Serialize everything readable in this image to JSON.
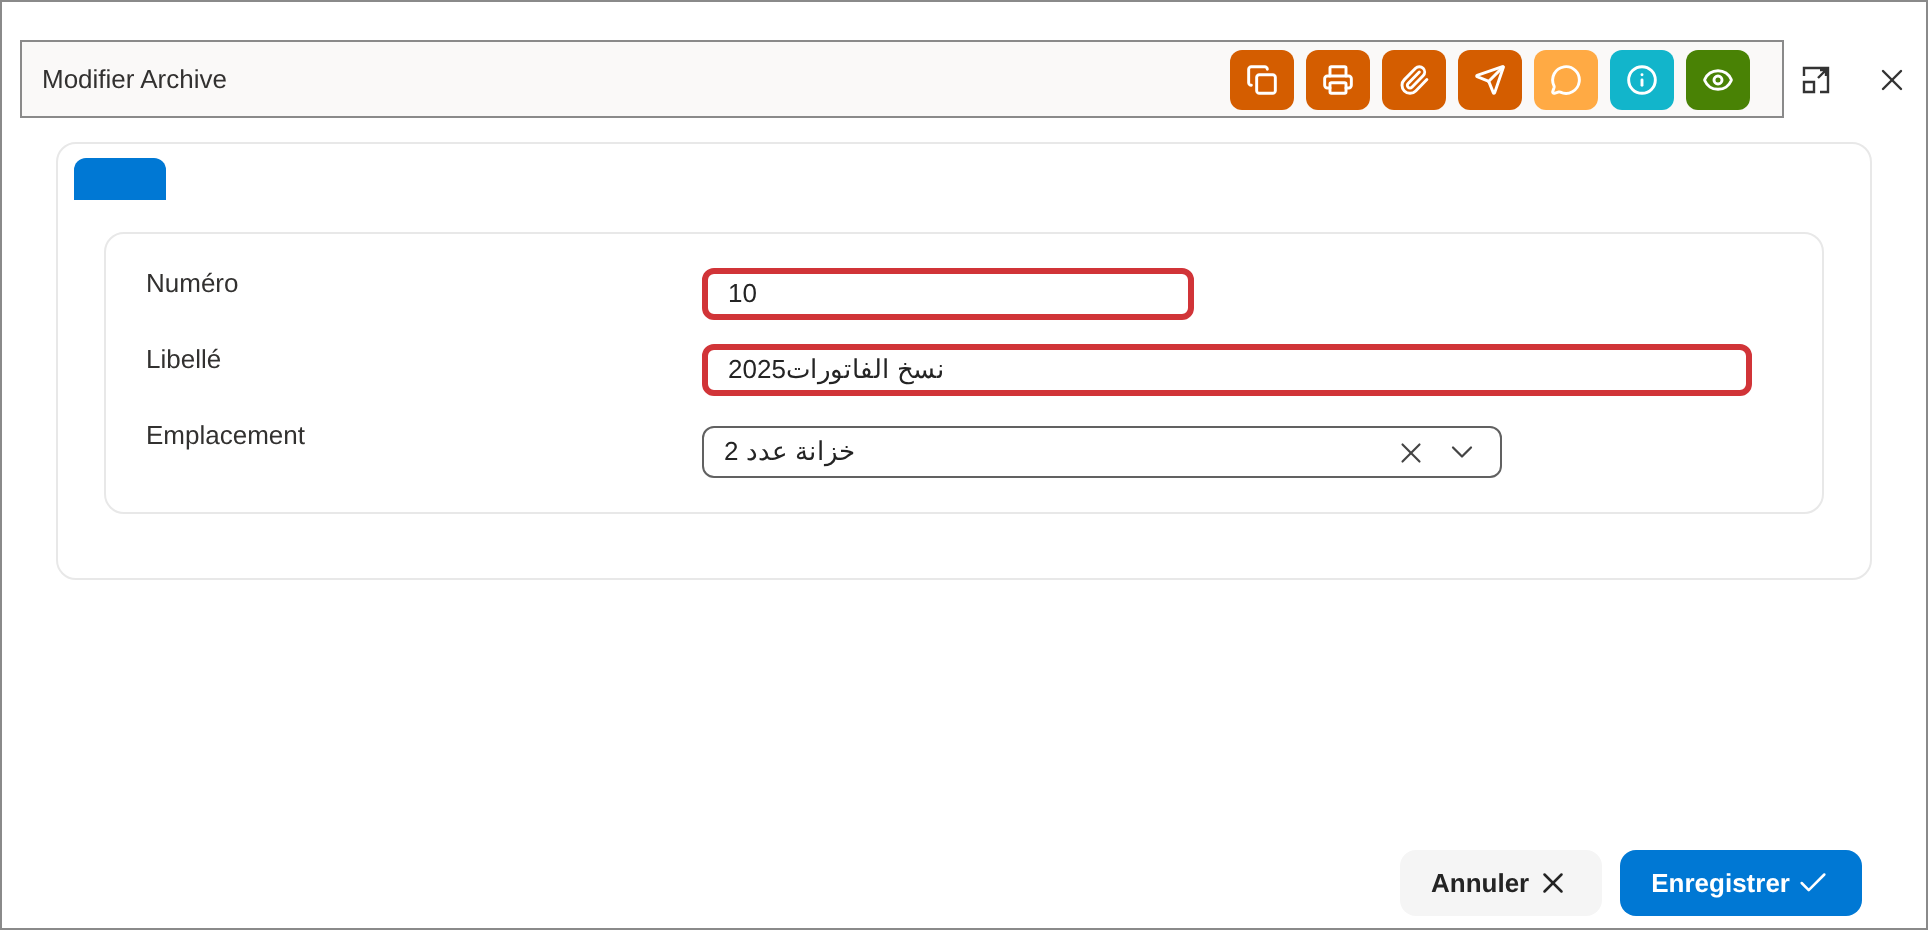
{
  "dialog": {
    "title": "Modifier Archive",
    "toolbar": [
      {
        "kind": "copy-print",
        "color": "#d45d00"
      },
      {
        "kind": "print",
        "color": "#d45d00"
      },
      {
        "kind": "attach",
        "color": "#d45d00"
      },
      {
        "kind": "send",
        "color": "#d45d00"
      },
      {
        "kind": "comment",
        "color": "#ffaa44"
      },
      {
        "kind": "info",
        "color": "#12b5cb"
      },
      {
        "kind": "view",
        "color": "#498205"
      }
    ]
  },
  "tabs": [
    {
      "selected": true
    }
  ],
  "form": [
    {
      "kind": "text",
      "label": "Numéro",
      "value": "10",
      "invalid": true
    },
    {
      "kind": "text",
      "label": "Libellé",
      "value": "نسخ الفاتورات2025",
      "invalid": true
    },
    {
      "kind": "select",
      "label": "Emplacement",
      "value": "خزانة عدد 2",
      "invalid": false
    }
  ],
  "buttons": [
    {
      "kind": "cancel",
      "label": "Annuler"
    },
    {
      "kind": "save",
      "label": "Enregistrer"
    }
  ]
}
